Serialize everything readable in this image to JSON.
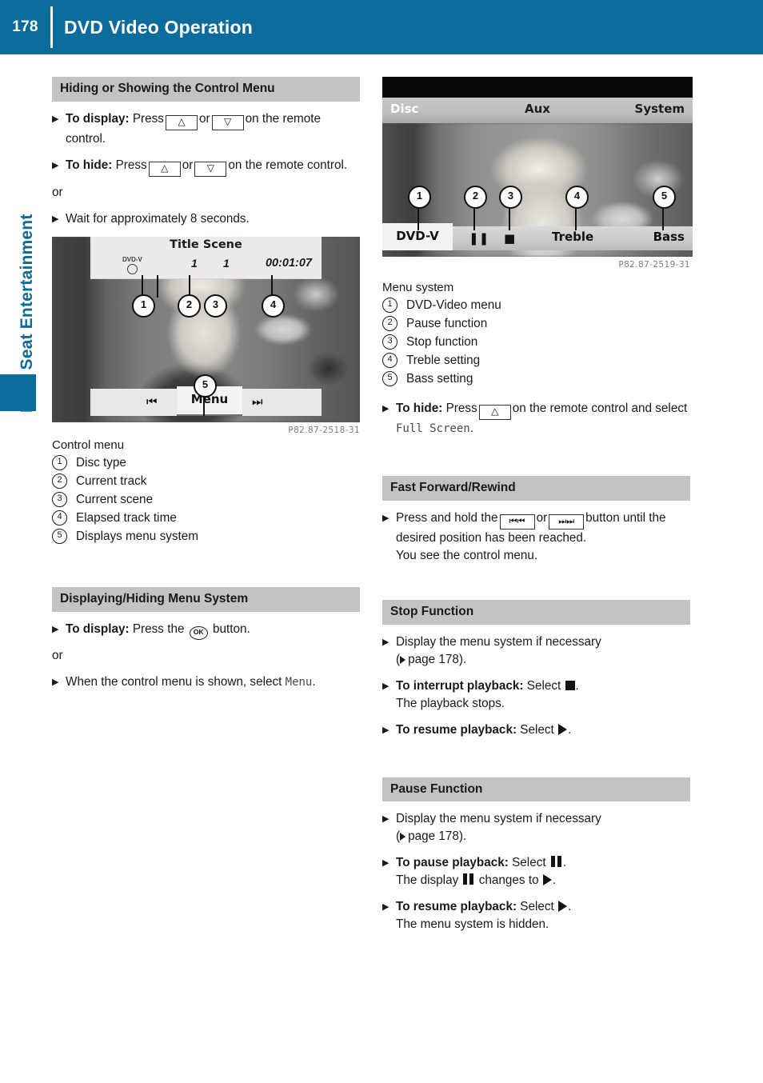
{
  "page": {
    "number": "178",
    "header_title": "DVD Video Operation",
    "chapter_tab": "Rear Seat Entertainment",
    "accent_blue": "#0c6d9c",
    "heading_bar_gray": "#c3c3c3"
  },
  "left_column": {
    "section1": {
      "heading": "Hiding or Showing the Control Menu",
      "step1_bold": "To display:",
      "step1_a": "Press",
      "step1_b": "or",
      "step1_c": "on the remote control.",
      "step2_bold": "To hide:",
      "step2_a": "Press",
      "step2_b": "or",
      "step2_c": "on the remote control.",
      "or_text": "or",
      "step3": "Wait for approximately 8 seconds.",
      "key_up": "△",
      "key_down": "▽"
    },
    "figure1": {
      "caption_code": "P82.87-2518-31",
      "osd_title_a": "Title",
      "osd_title_b": "Scene",
      "osd_disc_label": "DVD-V",
      "osd_track": "1",
      "osd_scene": "1",
      "osd_time": "00:01:07",
      "osd_menu": "Menu",
      "osd_prev": "⏮⏮",
      "osd_next": "⏭⏭",
      "callouts": [
        "1",
        "2",
        "3",
        "4",
        "5"
      ]
    },
    "legend1": {
      "caption": "Control menu",
      "items": [
        {
          "num": "1",
          "label": "Disc type"
        },
        {
          "num": "2",
          "label": "Current track"
        },
        {
          "num": "3",
          "label": "Current scene"
        },
        {
          "num": "4",
          "label": "Elapsed track time"
        },
        {
          "num": "5",
          "label": "Displays menu system"
        }
      ]
    },
    "section2": {
      "heading": "Displaying/Hiding Menu System",
      "step1_bold": "To display:",
      "step1_a": "Press the",
      "step1_ok": "OK",
      "step1_b": "button.",
      "or_text": "or",
      "step2_a": "When the control menu is shown, select",
      "step2_mono": "Menu",
      "step2_b": "."
    }
  },
  "right_column": {
    "figure2": {
      "caption_code": "P82.87-2519-31",
      "tab_disc": "Disc",
      "tab_aux": "Aux",
      "tab_system": "System",
      "ctl_dvdv": "DVD-V",
      "ctl_pause": "❘❘",
      "ctl_stop": "■",
      "ctl_treble": "Treble",
      "ctl_bass": "Bass",
      "callouts": [
        "1",
        "2",
        "3",
        "4",
        "5"
      ]
    },
    "legend2": {
      "caption": "Menu system",
      "items": [
        {
          "num": "1",
          "label": "DVD-Video menu"
        },
        {
          "num": "2",
          "label": "Pause function"
        },
        {
          "num": "3",
          "label": "Stop function"
        },
        {
          "num": "4",
          "label": "Treble setting"
        },
        {
          "num": "5",
          "label": "Bass setting"
        }
      ]
    },
    "hide_step": {
      "bold": "To hide:",
      "a": "Press",
      "key_up": "△",
      "b": "on the remote control and select",
      "mono": "Full Screen",
      "c": "."
    },
    "section_ff": {
      "heading": "Fast Forward/Rewind",
      "a": "Press and hold the",
      "key_rew": "⏮⏮",
      "b": "or",
      "key_ff": "⏭⏭",
      "c": "button until the desired position has been reached.",
      "d": "You see the control menu."
    },
    "section_stop": {
      "heading": "Stop Function",
      "step1_a": "Display the menu system if necessary",
      "step1_ref": "page 178",
      "step2_bold": "To interrupt playback:",
      "step2_a": "Select",
      "step2_b": ".",
      "step2_note": "The playback stops.",
      "step3_bold": "To resume playback:",
      "step3_a": "Select",
      "step3_b": "."
    },
    "section_pause": {
      "heading": "Pause Function",
      "step1_a": "Display the menu system if necessary",
      "step1_ref": "page 178",
      "step2_bold": "To pause playback:",
      "step2_a": "Select",
      "step2_b": ".",
      "step2_note_a": "The display",
      "step2_note_b": "changes to",
      "step2_note_c": ".",
      "step3_bold": "To resume playback:",
      "step3_a": "Select",
      "step3_b": ".",
      "step3_note": "The menu system is hidden."
    }
  }
}
